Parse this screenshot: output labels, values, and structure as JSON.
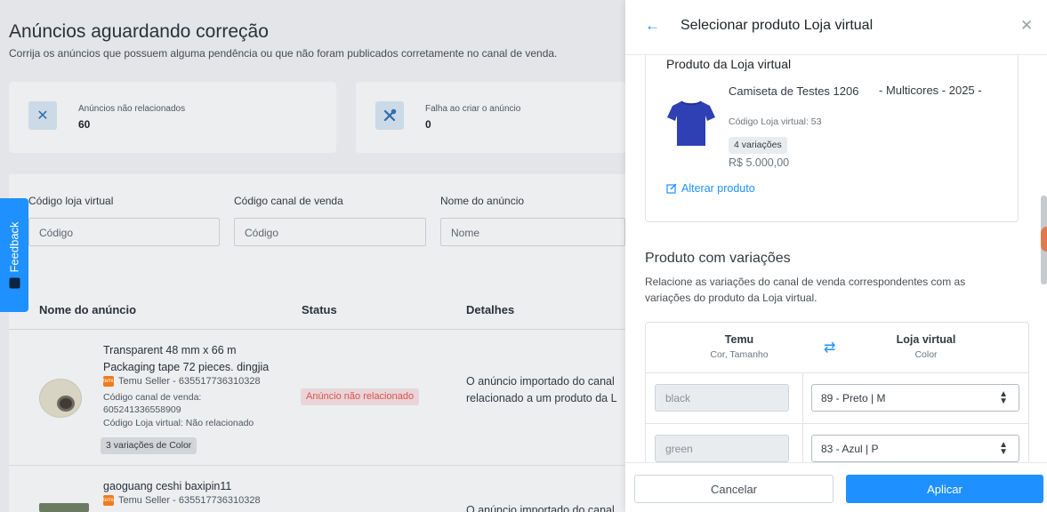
{
  "page": {
    "title": "Anúncios aguardando correção",
    "subtitle": "Corrija os anúncios que possuem alguma pendência ou que não foram publicados corretamente no canal de venda.",
    "stats": [
      {
        "label": "Anúncios não relacionados",
        "value": "60",
        "icon": "x-icon"
      },
      {
        "label": "Falha ao criar o anúncio",
        "value": "0",
        "icon": "tools-icon"
      }
    ],
    "filters": [
      {
        "label": "Código loja virtual",
        "placeholder": "Código"
      },
      {
        "label": "Código canal de venda",
        "placeholder": "Código"
      },
      {
        "label": "Nome do anúncio",
        "placeholder": "Nome"
      }
    ],
    "feedback_label": "Feedback",
    "table": {
      "headers": [
        "Nome do anúncio",
        "Status",
        "Detalhes"
      ],
      "rows": [
        {
          "name_line1": "Transparent 48 mm x 66 m",
          "name_line2": "Packaging tape 72 pieces. dingjia",
          "store": "Temu Seller - 635517736310328",
          "channel_code_label": "Código canal de venda:",
          "channel_code": "605241336558909",
          "store_code": "Código Loja virtual: Não relacionado",
          "variations": "3 variações de Color",
          "status": "Anúncio não relacionado",
          "details_line1": "O anúncio importado do canal",
          "details_line2": "relacionado a um produto da L"
        },
        {
          "name_line1": "gaoguang ceshi baxipin11",
          "store": "Temu Seller - 635517736310328",
          "details_line1": "O anúncio importado do canal"
        }
      ]
    }
  },
  "drawer": {
    "title": "Selecionar produto Loja virtual",
    "product_card": {
      "title": "Produto da Loja virtual",
      "name": "Camiseta de Testes 1206",
      "variant": "- Multicores - 2025 -",
      "code": "Código Loja virtual: 53",
      "variations": "4 variações",
      "price": "R$ 5.000,00",
      "change_link": "Alterar produto"
    },
    "variations_section": {
      "title": "Produto com variações",
      "description": "Relacione as variações do canal de venda correspondentes com as variações do produto da Loja virtual.",
      "source": {
        "title": "Temu",
        "subtitle": "Cor, Tamanho"
      },
      "target": {
        "title": "Loja virtual",
        "subtitle": "Color"
      },
      "rows": [
        {
          "source": "black",
          "target": "89 - Preto | M"
        },
        {
          "source": "green",
          "target": "83 - Azul | P"
        }
      ]
    },
    "footer": {
      "cancel": "Cancelar",
      "apply": "Aplicar"
    }
  },
  "colors": {
    "accent": "#1e90ff",
    "status_error": "#d9534f",
    "temu_orange": "#f07b1c"
  }
}
